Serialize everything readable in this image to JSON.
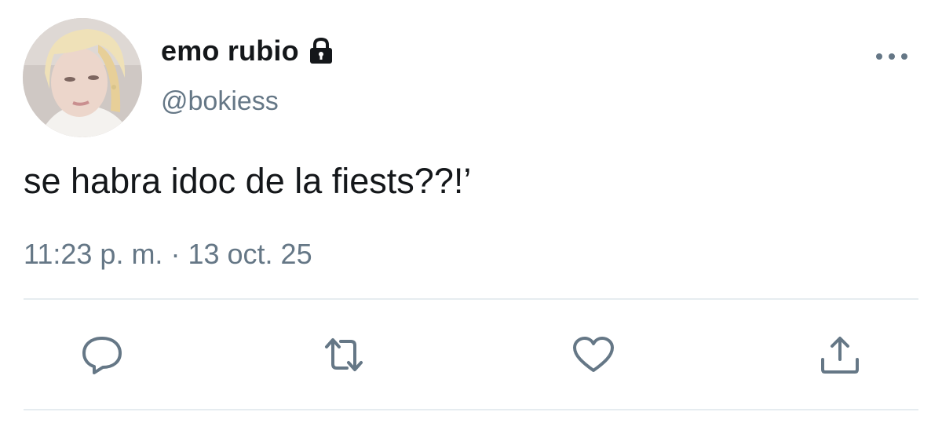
{
  "user": {
    "display_name": "emo rubio",
    "handle": "@bokiess",
    "protected_icon": "lock-icon"
  },
  "tweet": {
    "text": "se habra idoc de la fiests??!’",
    "time": "11:23 p. m.",
    "separator": "·",
    "date": "13 oct. 25"
  },
  "actions": {
    "reply_icon": "reply-icon",
    "retweet_icon": "retweet-icon",
    "like_icon": "heart-icon",
    "share_icon": "share-icon"
  },
  "menu": {
    "icon": "more-icon"
  },
  "colors": {
    "text": "#14171a",
    "secondary": "#657786",
    "divider": "#e6ecf0"
  }
}
